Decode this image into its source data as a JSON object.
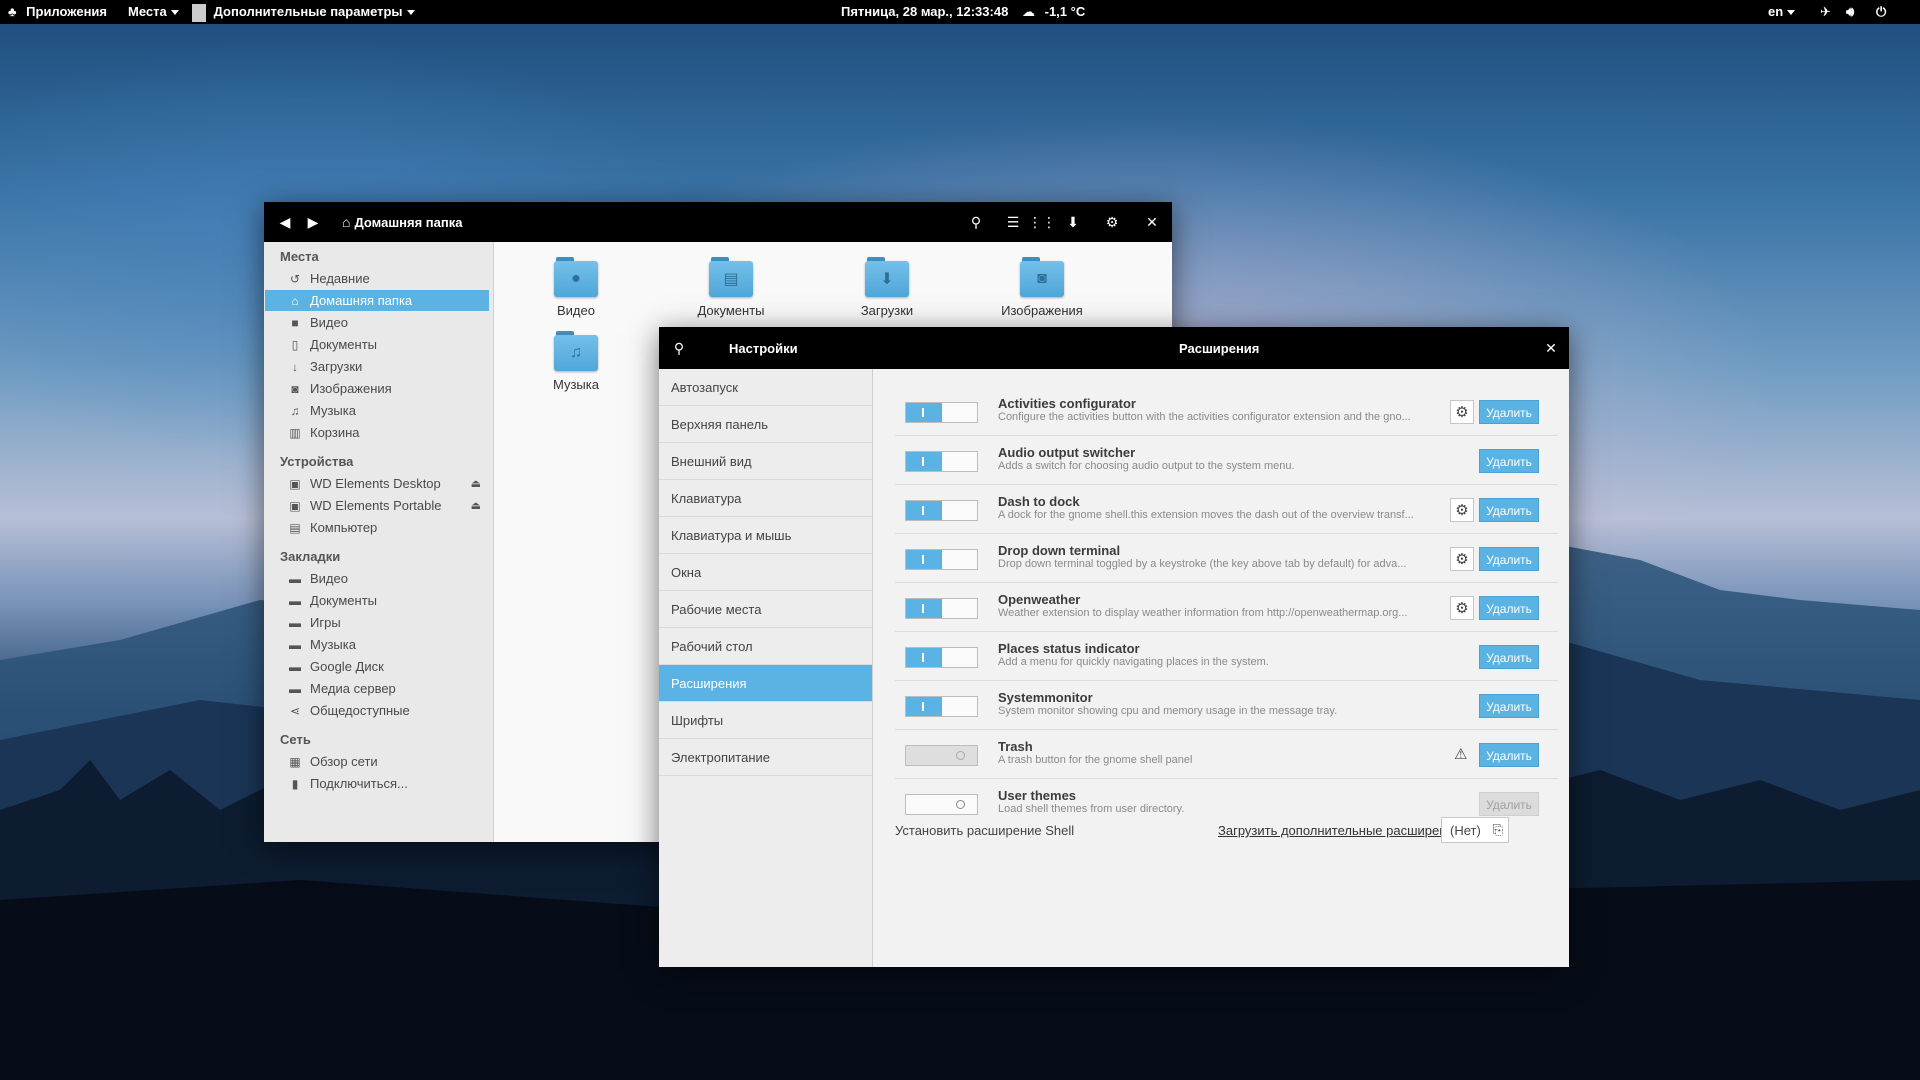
{
  "topbar": {
    "apps_label": "Приложения",
    "places_label": "Места",
    "extra_params_label": "Дополнительные параметры",
    "clock": "Пятница, 28 мар., 12:33:48",
    "weather": "-1,1 °C",
    "keyboard_layout": "en",
    "icons": [
      "gnome-foot-icon",
      "weather-cloud-icon",
      "network-icon",
      "volume-icon",
      "power-icon"
    ]
  },
  "file_manager": {
    "title": "Домашняя папка",
    "sidebar": {
      "sections": [
        {
          "header": "Места",
          "items": [
            {
              "label": "Недавние",
              "icon": "recent-icon"
            },
            {
              "label": "Домашняя папка",
              "icon": "home-icon",
              "active": true
            },
            {
              "label": "Видео",
              "icon": "video-icon"
            },
            {
              "label": "Документы",
              "icon": "document-icon"
            },
            {
              "label": "Загрузки",
              "icon": "download-icon"
            },
            {
              "label": "Изображения",
              "icon": "camera-icon"
            },
            {
              "label": "Музыка",
              "icon": "music-icon"
            },
            {
              "label": "Корзина",
              "icon": "trash-icon"
            }
          ]
        },
        {
          "header": "Устройства",
          "items": [
            {
              "label": "WD Elements Desktop",
              "icon": "drive-icon",
              "eject": true
            },
            {
              "label": "WD Elements Portable",
              "icon": "drive-icon",
              "eject": true
            },
            {
              "label": "Компьютер",
              "icon": "computer-icon"
            }
          ]
        },
        {
          "header": "Закладки",
          "items": [
            {
              "label": "Видео",
              "icon": "folder-icon"
            },
            {
              "label": "Документы",
              "icon": "folder-icon"
            },
            {
              "label": "Игры",
              "icon": "folder-icon"
            },
            {
              "label": "Музыка",
              "icon": "folder-icon"
            },
            {
              "label": "Google Диск",
              "icon": "folder-icon"
            },
            {
              "label": "Медиа сервер",
              "icon": "folder-icon"
            },
            {
              "label": "Общедоступные",
              "icon": "share-icon"
            }
          ]
        },
        {
          "header": "Сеть",
          "items": [
            {
              "label": "Обзор сети",
              "icon": "network-browse-icon"
            },
            {
              "label": "Подключиться...",
              "icon": "connect-icon"
            }
          ]
        }
      ]
    },
    "folders": [
      {
        "label": "Видео",
        "icon": "video-icon"
      },
      {
        "label": "Документы",
        "icon": "document-icon"
      },
      {
        "label": "Загрузки",
        "icon": "download-icon"
      },
      {
        "label": "Изображения",
        "icon": "camera-icon"
      },
      {
        "label": "Музыка",
        "icon": "music-icon"
      }
    ]
  },
  "settings": {
    "sidebar_title": "Настройки",
    "title": "Расширения",
    "categories": [
      {
        "label": "Автозапуск"
      },
      {
        "label": "Верхняя панель"
      },
      {
        "label": "Внешний вид"
      },
      {
        "label": "Клавиатура"
      },
      {
        "label": "Клавиатура и мышь"
      },
      {
        "label": "Окна"
      },
      {
        "label": "Рабочие места"
      },
      {
        "label": "Рабочий стол"
      },
      {
        "label": "Расширения",
        "active": true
      },
      {
        "label": "Шрифты"
      },
      {
        "label": "Электропитание"
      }
    ],
    "extensions": [
      {
        "name": "Activities configurator",
        "description": "Configure the activities button with the activities configurator extension and the gno...",
        "enabled": true,
        "has_settings": true,
        "delete_label": "Удалить"
      },
      {
        "name": "Audio output switcher",
        "description": "Adds a switch for choosing audio output to the system menu.",
        "enabled": true,
        "has_settings": false,
        "delete_label": "Удалить"
      },
      {
        "name": "Dash to dock",
        "description": "A dock for the gnome shell.this extension moves the dash out of the overview transf...",
        "enabled": true,
        "has_settings": true,
        "delete_label": "Удалить"
      },
      {
        "name": "Drop down terminal",
        "description": "Drop down terminal toggled by a keystroke (the key above tab by default) for adva...",
        "enabled": true,
        "has_settings": true,
        "delete_label": "Удалить"
      },
      {
        "name": "Openweather",
        "description": "Weather extension to display weather information from http://openweathermap.org...",
        "enabled": true,
        "has_settings": true,
        "delete_label": "Удалить"
      },
      {
        "name": "Places status indicator",
        "description": "Add a menu for quickly navigating places in the system.",
        "enabled": true,
        "has_settings": false,
        "delete_label": "Удалить"
      },
      {
        "name": "Systemmonitor",
        "description": "System monitor showing cpu and memory usage in the message tray.",
        "enabled": true,
        "has_settings": false,
        "delete_label": "Удалить"
      },
      {
        "name": "Trash",
        "description": "A trash button for the gnome shell panel",
        "enabled": false,
        "toggle_disabled": true,
        "warning": true,
        "has_settings": false,
        "delete_label": "Удалить"
      },
      {
        "name": "User themes",
        "description": "Load shell themes from user directory.",
        "enabled": false,
        "has_settings": false,
        "delete_disabled": true,
        "delete_label": "Удалить"
      }
    ],
    "install_label": "Установить расширение Shell",
    "more_link": "Загрузить дополнительные расширения",
    "file_chooser_value": "(Нет)"
  },
  "colors": {
    "accent": "#5bb3e3",
    "titlebar": "#000000"
  }
}
